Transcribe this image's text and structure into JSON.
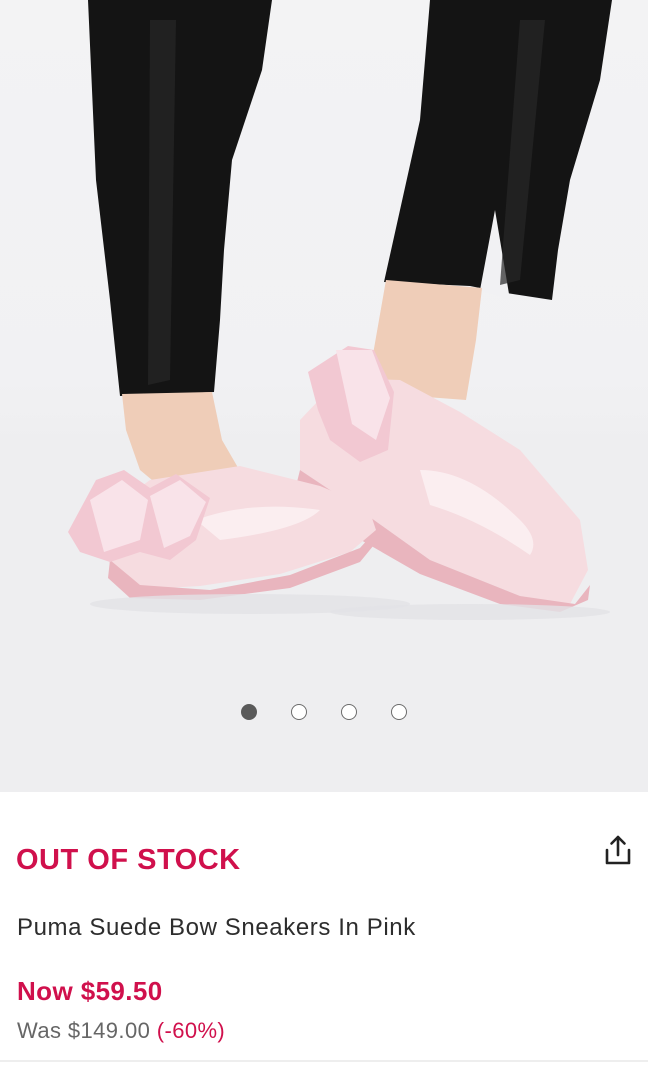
{
  "product": {
    "stock_status": "OUT OF STOCK",
    "name": "Puma Suede Bow Sneakers In Pink",
    "price_now": "Now $59.50",
    "price_was": "Was $149.00",
    "discount": "(-60%)"
  },
  "gallery": {
    "image_count": 4,
    "active_index": 0
  },
  "icons": {
    "share": "share-icon"
  },
  "colors": {
    "accent": "#d0104c",
    "text": "#2d2d2d",
    "muted": "#666666"
  }
}
